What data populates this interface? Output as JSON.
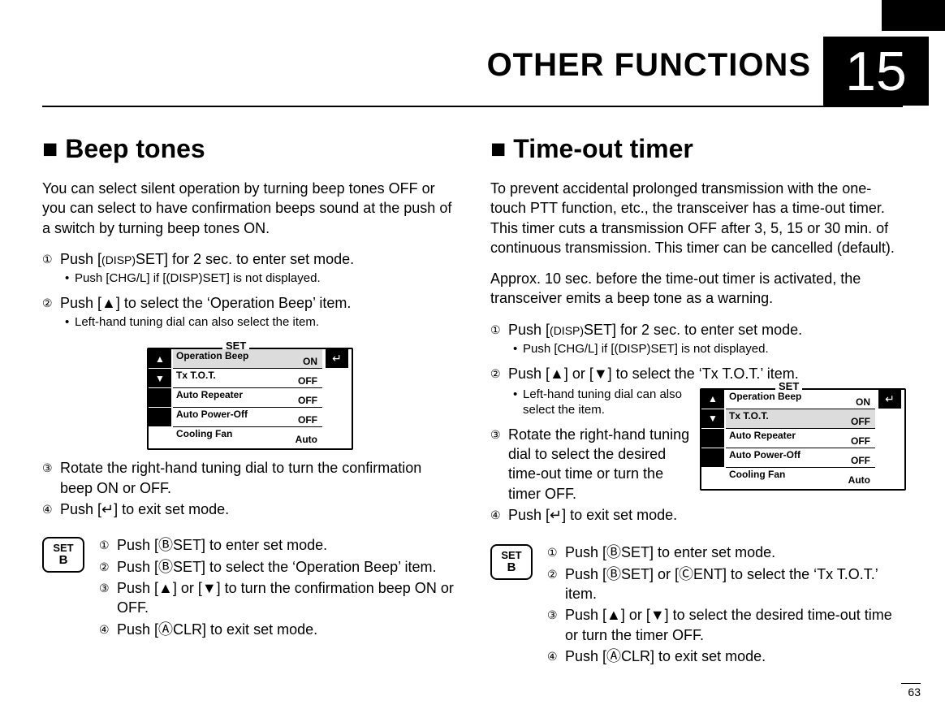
{
  "chapter": {
    "number": "15",
    "title": "OTHER FUNCTIONS"
  },
  "page_number": "63",
  "left": {
    "section_title": "■ Beep tones",
    "intro": "You can select silent operation by turning beep tones OFF or you can select to have confirmation beeps sound at the push of a switch by turning beep tones ON.",
    "step1_a": "Push [",
    "step1_disp": "(DISP)",
    "step1_b": "SET] for 2 sec. to enter set mode.",
    "bullet1": "Push [CHG/L] if [(DISP)SET] is not displayed.",
    "step2": "Push [▲] to select the ‘Operation Beep’ item.",
    "bullet2": "Left-hand tuning dial can also select the item.",
    "step3": "Rotate the right-hand tuning dial to turn the confirmation beep ON or OFF.",
    "step4": "Push [↵] to exit set mode.",
    "sub1": "Push [ⒷSET] to enter set mode.",
    "sub2": "Push [ⒷSET] to select the ‘Operation Beep’ item.",
    "sub3": "Push [▲] or [▼] to turn the confirmation beep ON or OFF.",
    "sub4": "Push [ⒶCLR] to exit set mode."
  },
  "right": {
    "section_title": "■ Time-out timer",
    "intro": "To prevent accidental prolonged transmission with the one-touch PTT function, etc., the transceiver has a time-out timer. This timer cuts a transmission OFF after 3, 5, 15 or 30 min. of continuous transmission. This timer can be cancelled (default).",
    "para2": "Approx. 10 sec. before the time-out timer is activated, the transceiver emits a beep tone as a warning.",
    "step1_a": "Push [",
    "step1_disp": "(DISP)",
    "step1_b": "SET] for 2 sec. to enter set mode.",
    "bullet1": "Push [CHG/L] if [(DISP)SET] is not displayed.",
    "step2": "Push [▲] or [▼] to select the ‘Tx T.O.T.’ item.",
    "bullet2": "Left-hand tuning dial can also select the item.",
    "step3": "Rotate the right-hand tuning dial to select the desired time-out time or turn the timer OFF.",
    "step4": "Push [↵] to exit set mode.",
    "sub1": "Push [ⒷSET] to enter set mode.",
    "sub2": "Push [ⒷSET] or [ⒸENT] to select the ‘Tx T.O.T.’ item.",
    "sub3": "Push [▲] or [▼] to select the desired time-out time or turn the timer OFF.",
    "sub4": "Push [ⒶCLR] to exit set mode."
  },
  "set_menu": {
    "title": "SET",
    "up": "▲",
    "down": "▼",
    "enter": "↵",
    "rows": [
      {
        "label": "Operation  Beep",
        "value": "ON"
      },
      {
        "label": "Tx  T.O.T.",
        "value": "OFF"
      },
      {
        "label": "Auto  Repeater",
        "value": "OFF"
      },
      {
        "label": "Auto  Power-Off",
        "value": "OFF"
      },
      {
        "label": "Cooling  Fan",
        "value": "Auto"
      }
    ]
  },
  "setb_key": {
    "top": "SET",
    "bot": "B"
  },
  "step_nums": {
    "n1": "①",
    "n2": "②",
    "n3": "③",
    "n4": "④"
  }
}
